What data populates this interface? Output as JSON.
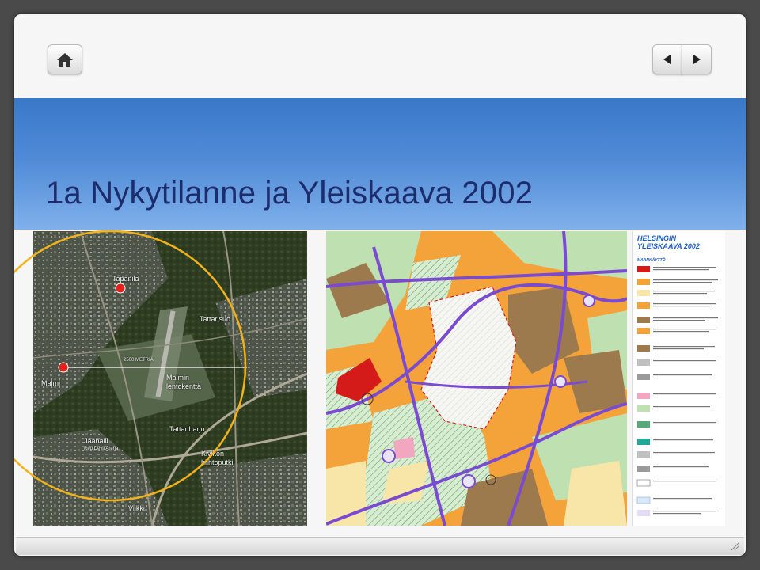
{
  "title": "1a Nykytilanne ja Yleiskaava 2002",
  "nav": {
    "home_icon": "home-icon",
    "prev_icon": "prev-arrow-icon",
    "next_icon": "next-arrow-icon"
  },
  "aerial": {
    "labels": {
      "tapanila": "Tapanila",
      "tattarisuo": "Tattarisuo",
      "distance": "2500 METRIÄ",
      "malmi": "Malmi",
      "airport_line1": "Malmin",
      "airport_line2": "lentokenttä",
      "tattariharju": "Tattariharju",
      "jaahalli": "Jäähalli",
      "red_devil_arena": "Red Devil Arena",
      "kivikon_line1": "Kivikon",
      "kivikon_line2": "hiihtoputki",
      "viikki": "Viikki"
    }
  },
  "legend": {
    "title_line1": "HELSINGIN",
    "title_line2": "YLEISKAAVA 2002",
    "section": "MAANKÄYTTÖ"
  },
  "colors": {
    "banner_top": "#3a78c8",
    "title_text": "#1c2c6c",
    "circle": "#f2b21a",
    "marker": "#e4211b",
    "zone_orange": "#f4a23a",
    "zone_brown": "#9c7a4e",
    "zone_green": "#bfe0b0",
    "road_purple": "#7a4bd1",
    "zone_red": "#d51a1a"
  }
}
